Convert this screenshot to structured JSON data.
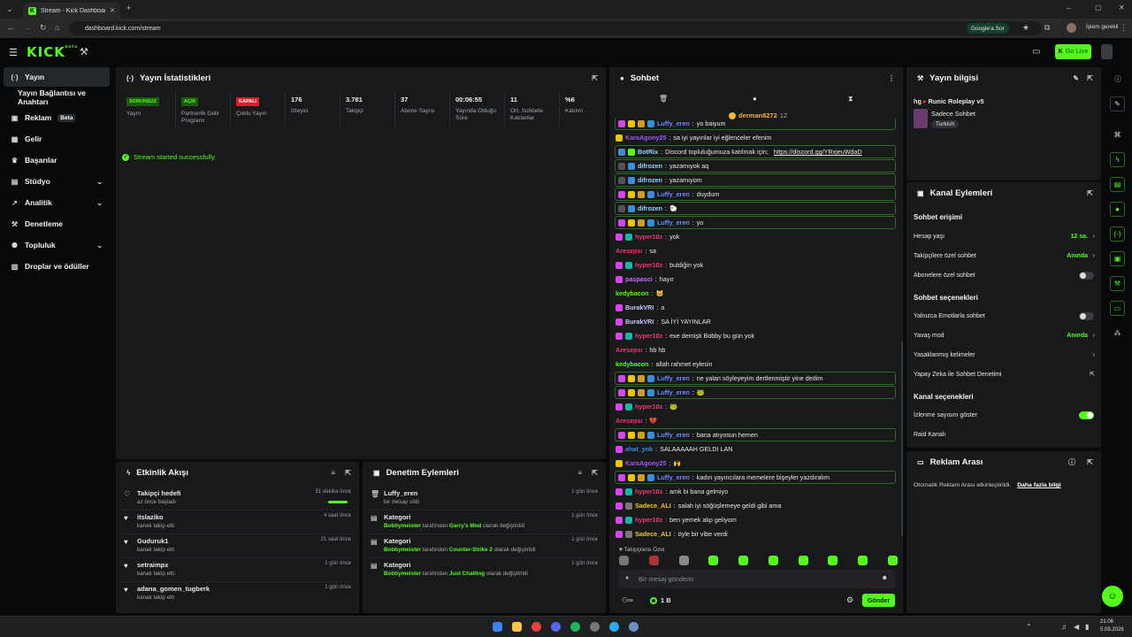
{
  "browser": {
    "tab_title": "Stream - Kick Dashboard",
    "new_tab": "+",
    "url": "dashboard.kick.com/stream",
    "google_pill": "Google'a Sor",
    "profile_label": "İşlem gerekli",
    "window_min": "–",
    "window_max": "▢",
    "window_close": "✕"
  },
  "app": {
    "logo": "KICK",
    "logo_small": "beta",
    "go_live_label": "Go Live"
  },
  "sidebar": {
    "items": [
      {
        "label": "Yayın",
        "icon": "(·)"
      },
      {
        "label": "Yayın Bağlantısı ve Anahtarı",
        "icon": ""
      },
      {
        "label": "Reklam",
        "icon": "▣",
        "badge": "Beta"
      },
      {
        "label": "Gelir",
        "icon": "▦"
      },
      {
        "label": "Başarılar",
        "icon": "♛"
      },
      {
        "label": "Stüdyo",
        "icon": "▤"
      },
      {
        "label": "Analitik",
        "icon": "↗"
      },
      {
        "label": "Denetleme",
        "icon": "⚒"
      },
      {
        "label": "Topluluk",
        "icon": "⚉"
      },
      {
        "label": "Droplar ve ödüller",
        "icon": "▥"
      }
    ]
  },
  "stats_panel": {
    "title": "Yayın İstatistikleri",
    "stats": [
      {
        "tag": "SORUNSUZ",
        "label": "Yayın",
        "tag_color": "#53fc18"
      },
      {
        "tag": "AÇIK",
        "label": "Partnerlik Gelir Programı",
        "tag_color": "#53fc18"
      },
      {
        "tag": "KAPALI",
        "label": "Çoklu Yayın",
        "tag_color": "#e0192a"
      },
      {
        "value": "176",
        "label": "İzleyici"
      },
      {
        "value": "3.781",
        "label": "Takipçi"
      },
      {
        "value": "37",
        "label": "Abone Sayısı"
      },
      {
        "value": "00:06:55",
        "label": "Yayında Olduğu Süre"
      },
      {
        "value": "11",
        "label": "Ort. Sohbete Katılanlar"
      },
      {
        "value": "%6",
        "label": "Katılım"
      }
    ],
    "success_message": "Stream started successfully."
  },
  "activity_panel": {
    "title": "Etkinlik Akışı",
    "items": [
      {
        "title": "Takipçi hedefi",
        "sub": "az önce başladı",
        "time": "51 dakika önce",
        "icon": "♡"
      },
      {
        "title": "itslaziko",
        "sub": "kanalı takip etti",
        "time": "4 saat önce",
        "icon": "♥"
      },
      {
        "title": "Guduruk1",
        "sub": "kanalı takip etti",
        "time": "21 saat önce",
        "icon": "♥"
      },
      {
        "title": "setraimpx",
        "sub": "kanalı takip etti",
        "time": "1 gün önce",
        "icon": "♥"
      },
      {
        "title": "adana_gomen_tugberk",
        "sub": "kanalı takip etti",
        "time": "1 gün önce",
        "icon": "♥"
      }
    ]
  },
  "mod_panel": {
    "title": "Denetim Eylemleri",
    "items": [
      {
        "title": "Luffy_eren",
        "pre": "bir mesajı sildi",
        "mid": "",
        "post": "",
        "time": "1 gün önce",
        "icon": "🗑"
      },
      {
        "title": "Kategori",
        "pre": "Bobbymeister",
        "mid": " tarafından ",
        "cat": "Garry's Mod",
        "post": " olarak değiştirildi",
        "time": "1 gün önce",
        "icon": "▤"
      },
      {
        "title": "Kategori",
        "pre": "Bobbymeister",
        "mid": " tarafından ",
        "cat": "Counter-Strike 2",
        "post": " olarak değiştirildi",
        "time": "1 gün önce",
        "icon": "▤"
      },
      {
        "title": "Kategori",
        "pre": "Bobbymeister",
        "mid": " tarafından ",
        "cat": "Just Chatting",
        "post": " olarak değiştirildi",
        "time": "1 gün önce",
        "icon": "▤"
      }
    ]
  },
  "chat_panel": {
    "title": "Sohbet",
    "pinned_user": "derman8272",
    "pinned_count": "12",
    "messages": [
      {
        "user": "Luffy_eren",
        "text": "yo baiyum",
        "color": "#6a8cff",
        "hl": true,
        "badges": [
          "#d946ef",
          "#e8c600",
          "#d0a020",
          "#3c8dd8"
        ]
      },
      {
        "user": "KaraAgony25",
        "text": "sa iyi yayınlar iyi eğlenceler efenim",
        "color": "#a855f7",
        "hl": false,
        "badges": [
          "#e8c600"
        ]
      },
      {
        "user": "BotRix",
        "text": "Discord topluluğumuza katılmak için;",
        "link": "https://discord.gg/YRxjeuWdaD",
        "color": "#8fd8ff",
        "hl": true,
        "badges": [
          "#3c8dd8",
          "#53fc18"
        ]
      },
      {
        "user": "difrozen",
        "text": "yazamıyok aq",
        "color": "#8fd8ff",
        "hl": true,
        "badges": [
          "#555",
          "#3c8dd8"
        ]
      },
      {
        "user": "difrozen",
        "text": "yazamıyom",
        "color": "#8fd8ff",
        "hl": true,
        "badges": [
          "#555",
          "#3c8dd8"
        ]
      },
      {
        "user": "Luffy_eren",
        "text": "duydum",
        "color": "#6a8cff",
        "hl": true,
        "badges": [
          "#d946ef",
          "#e8c600",
          "#d0a020",
          "#3c8dd8"
        ]
      },
      {
        "user": "difrozen",
        "text": "🐑",
        "color": "#8fd8ff",
        "hl": true,
        "badges": [
          "#555",
          "#3c8dd8"
        ]
      },
      {
        "user": "Luffy_eren",
        "text": "yo",
        "color": "#6a8cff",
        "hl": true,
        "badges": [
          "#d946ef",
          "#e8c600",
          "#d0a020",
          "#3c8dd8"
        ]
      },
      {
        "user": "hyper10z",
        "text": "yok",
        "color": "#f0386b",
        "hl": false,
        "badges": [
          "#d946ef",
          "#14b8a6"
        ]
      },
      {
        "user": "Aresepsı",
        "text": "sa",
        "color": "#f0386b",
        "hl": false,
        "badges": []
      },
      {
        "user": "hyper10z",
        "text": "buldiğin yok",
        "color": "#f0386b",
        "hl": false,
        "badges": [
          "#d946ef",
          "#14b8a6"
        ]
      },
      {
        "user": "paspasci",
        "text": "hayır",
        "color": "#c86cff",
        "hl": false,
        "badges": [
          "#d946ef"
        ]
      },
      {
        "user": "kedybacon",
        "text": "🐱",
        "color": "#53fc18",
        "hl": false,
        "badges": []
      },
      {
        "user": "BurakVRI",
        "text": "a",
        "color": "#c8c8ff",
        "hl": false,
        "badges": [
          "#d946ef"
        ]
      },
      {
        "user": "BurakVRI",
        "text": "SA İYİ YAYINLAR",
        "color": "#c8c8ff",
        "hl": false,
        "badges": [
          "#d946ef"
        ]
      },
      {
        "user": "hyper10z",
        "text": "exe demişti Bobby bu gün yok",
        "color": "#f0386b",
        "hl": false,
        "badges": [
          "#d946ef",
          "#14b8a6"
        ]
      },
      {
        "user": "Aresepsı",
        "text": "hb hb",
        "color": "#f0386b",
        "hl": false,
        "badges": []
      },
      {
        "user": "kedybacon",
        "text": "allah rahmet eylesin",
        "color": "#53fc18",
        "hl": false,
        "badges": []
      },
      {
        "user": "Luffy_eren",
        "text": "ne yalan söyleyeyim dertlenmiştir yine dedim",
        "color": "#6a8cff",
        "hl": true,
        "badges": [
          "#d946ef",
          "#e8c600",
          "#d0a020",
          "#3c8dd8"
        ]
      },
      {
        "user": "Luffy_eren",
        "text": "🐸",
        "color": "#6a8cff",
        "hl": true,
        "badges": [
          "#d946ef",
          "#e8c600",
          "#d0a020",
          "#3c8dd8"
        ]
      },
      {
        "user": "hyper10z",
        "text": "🐸",
        "color": "#f0386b",
        "hl": false,
        "badges": [
          "#d946ef",
          "#14b8a6"
        ]
      },
      {
        "user": "Aresepsı",
        "text": "💔",
        "color": "#f0386b",
        "hl": false,
        "badges": []
      },
      {
        "user": "Luffy_eren",
        "text": "bana atıyosun hemen",
        "color": "#6a8cff",
        "hl": true,
        "badges": [
          "#d946ef",
          "#e8c600",
          "#d0a020",
          "#3c8dd8"
        ]
      },
      {
        "user": "ahat_ynk",
        "text": "SALAAAAAH GELDI LAN",
        "color": "#3c8dd8",
        "hl": false,
        "badges": [
          "#d946ef"
        ]
      },
      {
        "user": "KaraAgony25",
        "text": "🙌",
        "color": "#a855f7",
        "hl": false,
        "badges": [
          "#e8c600"
        ]
      },
      {
        "user": "Luffy_eren",
        "text": "kadın yayıncılara memelere bişeyler yazdıralım",
        "color": "#6a8cff",
        "hl": true,
        "badges": [
          "#d946ef",
          "#e8c600",
          "#d0a020",
          "#3c8dd8"
        ]
      },
      {
        "user": "hyper10z",
        "text": "amk bi bana gelmiyo",
        "color": "#f0386b",
        "hl": false,
        "badges": [
          "#d946ef",
          "#14b8a6"
        ]
      },
      {
        "user": "Sadece_ALI",
        "text": "salah iyi söğüşlemeye geldi gibi ama",
        "color": "#f3c623",
        "hl": false,
        "badges": [
          "#d946ef",
          "#777"
        ]
      },
      {
        "user": "hyper10z",
        "text": "ben yemek alıp geliyom",
        "color": "#f0386b",
        "hl": false,
        "badges": [
          "#d946ef",
          "#14b8a6"
        ]
      },
      {
        "user": "Sadece_ALI",
        "text": "öyle bir vibe verdi",
        "color": "#f3c623",
        "hl": false,
        "badges": [
          "#d946ef",
          "#777"
        ]
      }
    ],
    "emote_section_label": "Takipçilere Özel",
    "input_placeholder": "Bir mesaj gönderin",
    "points_value": "1 B",
    "send_label": "Gönder"
  },
  "stream_info": {
    "title": "Yayın bilgisi",
    "stream_title": "Runic Roleplay v5",
    "title_prefix": "hg",
    "category": "Sadece Sohbet",
    "language": "Turkish"
  },
  "channel_actions": {
    "title": "Kanal Eylemleri",
    "chat_access": "Sohbet erişimi",
    "account_age": "Hesap yaşı",
    "account_age_value": "12 sa.",
    "followers_only": "Takipçilere özel sohbet",
    "followers_only_value": "Anında",
    "subscribers_only": "Abonelere özel sohbet",
    "chat_options": "Sohbet seçenekleri",
    "emotes_only": "Yalnızca Emotlarla sohbet",
    "slow_mode": "Yavaş mod",
    "slow_mode_value": "Anında",
    "banned_words": "Yasaklanmış kelimeler",
    "ai_moderation": "Yapay Zeka ile Sohbet Denetimi",
    "channel_options": "Kanal seçenekleri",
    "show_viewers": "İzlenme sayısını göster",
    "raid": "Raid Kanalı"
  },
  "ad_break": {
    "title": "Reklam Arası",
    "text": "Otomatik Reklam Arası etkinleştirildi.",
    "link": "Daha fazla bilgi"
  },
  "taskbar": {
    "time": "21:06",
    "date": "5.08.2026"
  }
}
